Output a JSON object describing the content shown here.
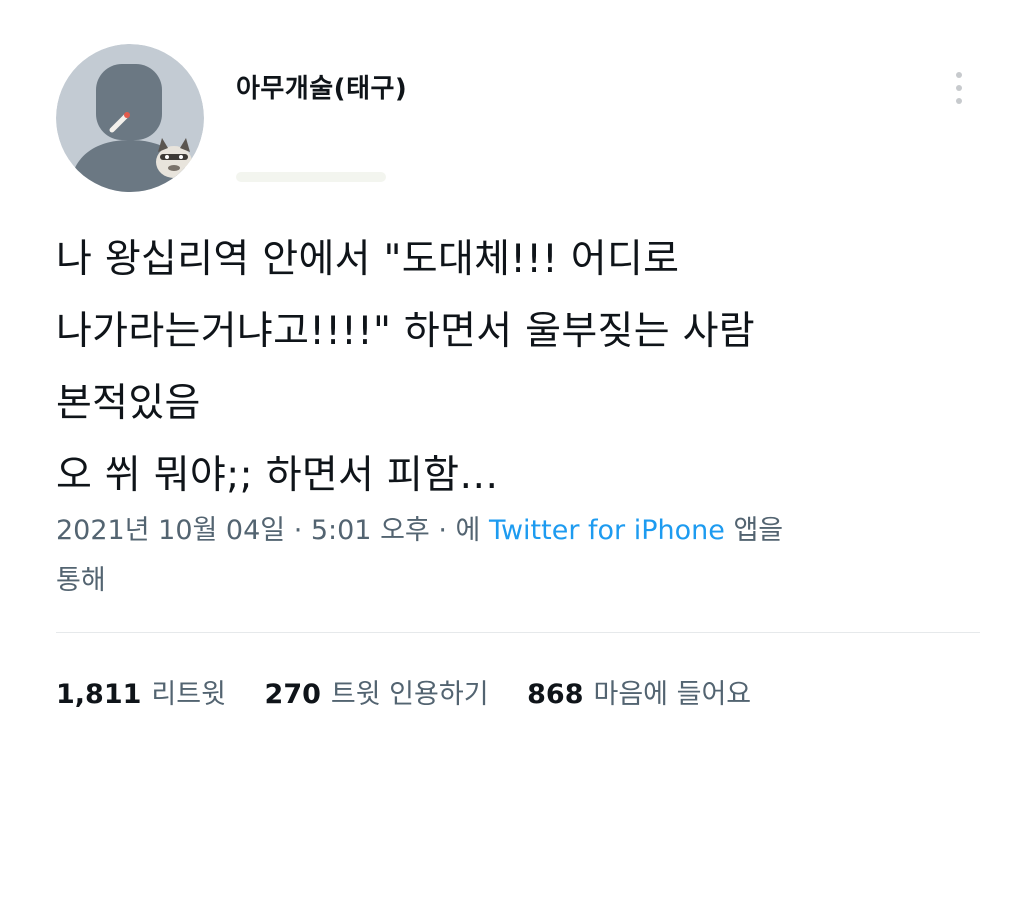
{
  "author": {
    "display_name": "아무개술(태구)",
    "avatar_icon": "person-silhouette-with-cat-icon"
  },
  "tweet": {
    "lines": [
      "나 왕십리역 안에서 \"도대체!!! 어디로",
      "나가라는거냐고!!!!\" 하면서 울부짖는 사람",
      "본적있음",
      "오 쒸 뭐야;; 하면서 피함…"
    ]
  },
  "meta": {
    "timestamp": "2021년 10월 04일 · 5:01 오후 · 에",
    "source": "Twitter for iPhone",
    "suffix_1": "앱을",
    "suffix_2": "통해"
  },
  "stats": {
    "retweets_count": "1,811",
    "retweets_label": "리트윗",
    "quotes_count": "270",
    "quotes_label": "트윗 인용하기",
    "likes_count": "868",
    "likes_label": "마음에 들어요"
  },
  "colors": {
    "link": "#1d9bf0",
    "secondary_text": "#536471",
    "primary_text": "#0f1419",
    "avatar_bg": "#c3cbd3",
    "avatar_figure": "#6b7883"
  }
}
